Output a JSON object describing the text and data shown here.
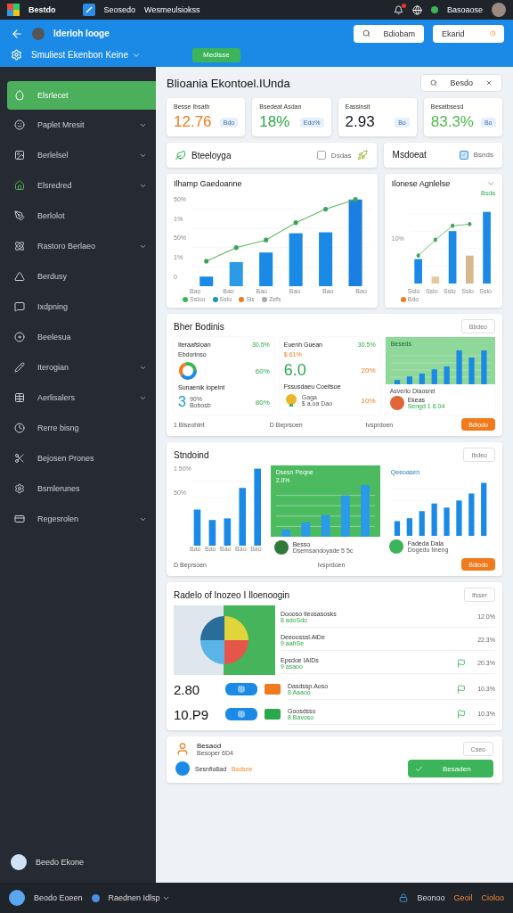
{
  "top_bar": {
    "app_name": "Bestdo",
    "links": [
      "Seosedo",
      "Wesmeulsiokss"
    ],
    "user": "Basoaose",
    "notification": true
  },
  "header": {
    "account": "Iderioh Iooge",
    "project": "Smuliest Ekenbon Keine",
    "action": "Medisse",
    "buttons": [
      "Bdiobam",
      "Ekarid"
    ]
  },
  "sidebar": {
    "items": [
      {
        "label": "Elsrlecet",
        "selected": true,
        "expandable": false
      },
      {
        "label": "Paplet Mresit",
        "selected": false,
        "expandable": true
      },
      {
        "label": "Berlelsel",
        "selected": false,
        "expandable": true
      },
      {
        "label": "Elsredred",
        "selected": false,
        "expandable": true
      },
      {
        "label": "Berlolot",
        "selected": false,
        "expandable": false
      },
      {
        "label": "Rastoro Berlaeo",
        "selected": false,
        "expandable": true
      },
      {
        "label": "Berdusy",
        "selected": false,
        "expandable": false
      },
      {
        "label": "Ixdpning",
        "selected": false,
        "expandable": false
      },
      {
        "label": "Beelesua",
        "selected": false,
        "expandable": false
      },
      {
        "label": "Iterogian",
        "selected": false,
        "expandable": true
      },
      {
        "label": "Aerlisalers",
        "selected": false,
        "expandable": true
      },
      {
        "label": "Rerre bisng",
        "selected": false,
        "expandable": false
      },
      {
        "label": "Bejosen Prones",
        "selected": false,
        "expandable": false
      },
      {
        "label": "Bsmlerunes",
        "selected": false,
        "expandable": false
      },
      {
        "label": "Regesrolen",
        "selected": false,
        "expandable": true
      }
    ],
    "footer": "Beedo Ekone"
  },
  "page": {
    "title": "Blioania Ekontoel.IUnda",
    "button": "Besdo"
  },
  "kpis": [
    {
      "label": "Besse Ibsath",
      "value": "12.76",
      "badge": "Bdo",
      "color": "#f07a1c"
    },
    {
      "label": "Bsedeat Asdan",
      "value": "18%",
      "badge": "Edo%",
      "color": "#2aa84a"
    },
    {
      "label": "Eassinsit",
      "value": "2.93",
      "badge": "Bo",
      "color": "#14181f"
    },
    {
      "label": "Besatbsesd",
      "value": "83.3%",
      "badge": "Bo",
      "color": "#4cbb4a"
    }
  ],
  "toolbar_cards": [
    {
      "title": "Bteeloyga",
      "option": "Dsdas",
      "checked": false
    },
    {
      "title": "Msdoeat",
      "option": "Bsnds",
      "checked": true
    }
  ],
  "charts": [
    {
      "title": "Ilhamp Gaedoanne",
      "y_labels": [
        "50%",
        "1%",
        "50%",
        "1%",
        "0"
      ],
      "x_labels": [
        "Bao",
        "Bao",
        "Bao",
        "Bao",
        "Bao",
        "Bao"
      ],
      "legend": [
        "Ssloo",
        "Ssio",
        "Sis",
        "Zefs"
      ]
    },
    {
      "title": "Ilonese Agnlelse",
      "y_labels": [
        "10%"
      ],
      "x_labels": [
        "Sslo",
        "Sslo",
        "Sslo",
        "Sslo",
        "Sslo"
      ],
      "legend": [
        "Bdo"
      ],
      "peak": "Bsda"
    }
  ],
  "summary": {
    "title": "Bher Bodinis",
    "button": "Bbdeo",
    "cards": [
      {
        "title": "Iteraafsloan",
        "change": "30.5%",
        "subtitle": "Ebdorinso",
        "metric": "60%",
        "second_title": "Sunaenik Iopelnt",
        "second_value": "3",
        "second_lines": [
          "90%",
          "Bobosb"
        ],
        "second_metric": "80%"
      },
      {
        "title": "Euenh Guean",
        "change": "30.5%",
        "subtitle": "$ 61%",
        "value": "6.0",
        "metric": "20%",
        "second_title": "Fssusdaeu Coeitsoe",
        "second_lines": [
          "Gaga",
          "$ a.oa Dao"
        ],
        "second_metric": "10%"
      }
    ],
    "chart_panel": {
      "title": "Beseds",
      "caption": "Asverlo Dlaosrel",
      "name": "Ekeas",
      "detail": "Sengd 1 6.04"
    },
    "footer": [
      "1 Biseohlnt",
      "D Beprsoen",
      "Ivsprdoen"
    ],
    "action": "Bdiodo"
  },
  "trends": {
    "title": "Stndoind",
    "button": "Ibdeo",
    "y_labels": [
      "1 50%",
      "50%"
    ],
    "x_labels": [
      "Bao",
      "Bao",
      "Bao",
      "Bao",
      "Bao"
    ],
    "panels": [
      {
        "title": "Dsesn Peqne",
        "value": "2.0%",
        "name": "Besso",
        "detail": "Dsemsandoyade 5 5c"
      },
      {
        "title": "Qeeoasen",
        "name": "Fadeda Dala",
        "detail": "Dogedu Ilneng"
      }
    ],
    "footer": [
      "D Beprsoen",
      "Ivsprdoen"
    ],
    "action": "Bdiodo"
  },
  "ranking": {
    "title": "Radelo of Inozeo I Iloenoogin",
    "button": "Ifsser",
    "rows": [
      {
        "kind": "item",
        "title": "Doooso Ileosasosks",
        "sub": "8 adoSdo",
        "value": "12.0%",
        "flag": false
      },
      {
        "kind": "item",
        "title": "Deeoosssl.AiDe",
        "sub": "9 aahSe",
        "value": "22.3%",
        "flag": false
      },
      {
        "kind": "item",
        "title": "Epsdoe IAIDs",
        "sub": "9 asaoo",
        "value": "20.3%",
        "flag": true
      },
      {
        "kind": "total",
        "lead": "2.80",
        "title": "Dasdssp.Aoso",
        "sub": "8 Aaaoo",
        "value": "10.3%",
        "flag": true
      },
      {
        "kind": "total",
        "lead": "10.P9",
        "title": "Goosdsso",
        "sub": "8 Bavoso",
        "value": "10.3%",
        "flag": true
      }
    ]
  },
  "note": {
    "title": "Besaod",
    "sub": "Besoper 6D4",
    "link": "Sesnfio8ad",
    "highlight": "Bsdsne",
    "button": "Besaden",
    "small_button": "Cseo"
  },
  "bottom_bar": {
    "left": [
      "Beodo Eoeen",
      "Raednen Idlsp"
    ],
    "right": [
      "Beonoo",
      "Geoil",
      "Cioloo"
    ]
  }
}
